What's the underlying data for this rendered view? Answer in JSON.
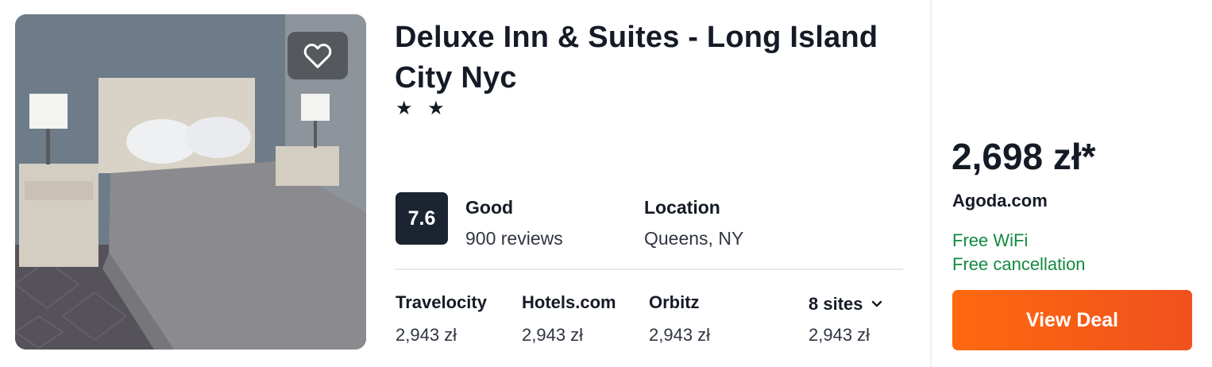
{
  "hotel": {
    "name": "Deluxe Inn & Suites - Long Island City Nyc",
    "star_display": "★ ★",
    "stars": 2,
    "favorite_icon": "heart-icon",
    "photo_alt": "Hotel room with bed"
  },
  "rating": {
    "score": "7.6",
    "label": "Good",
    "reviews": "900 reviews"
  },
  "location": {
    "label": "Location",
    "value": "Queens, NY"
  },
  "other_sites": [
    {
      "name": "Travelocity",
      "price": "2,943 zł"
    },
    {
      "name": "Hotels.com",
      "price": "2,943 zł"
    },
    {
      "name": "Orbitz",
      "price": "2,943 zł"
    }
  ],
  "more_sites": {
    "label": "8 sites",
    "price": "2,943 zł",
    "icon": "chevron-down-icon"
  },
  "deal": {
    "price": "2,698 zł*",
    "provider": "Agoda.com",
    "perks": [
      "Free WiFi",
      "Free cancellation"
    ],
    "button_label": "View Deal"
  },
  "colors": {
    "accent": "#ff690f",
    "perk_green": "#138a3f",
    "score_bg": "#1b2430"
  }
}
